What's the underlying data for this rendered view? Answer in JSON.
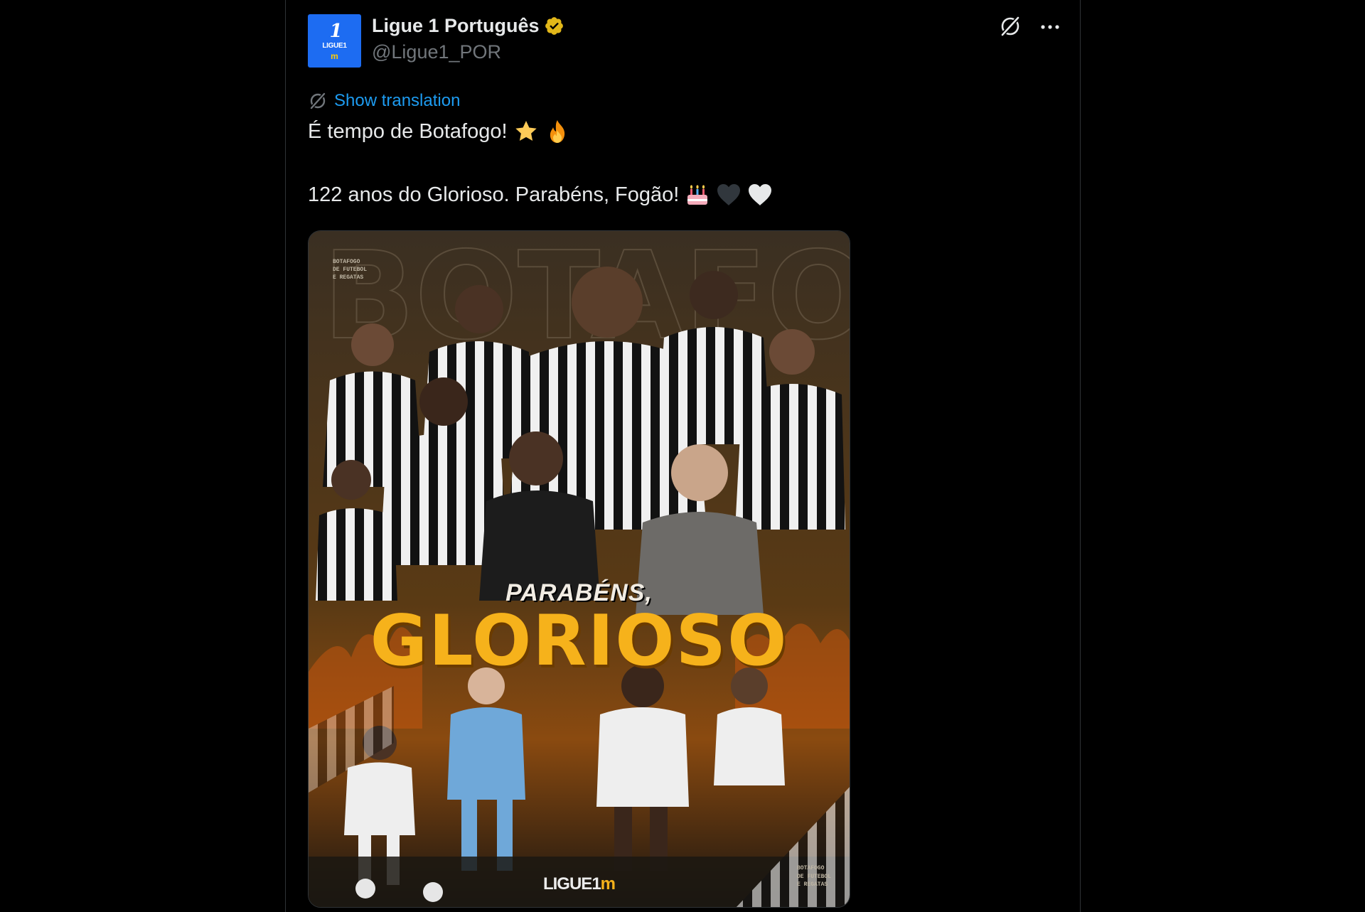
{
  "account": {
    "display_name": "Ligue 1 Português",
    "handle": "@Ligue1_POR",
    "avatar_text": "LIGUE1",
    "verified_color": "#e2b719"
  },
  "actions": {
    "grok_icon": "grok-icon",
    "more_icon": "more-horizontal-icon"
  },
  "translation": {
    "label": "Show translation"
  },
  "tweet": {
    "line1": "É tempo de Botafogo!",
    "line1_emojis": [
      "star",
      "fire"
    ],
    "line2": "122 anos do Glorioso. Parabéns, Fogão!",
    "line2_emojis": [
      "birthday-cake",
      "black-heart",
      "white-heart"
    ]
  },
  "media": {
    "club_text_top": "BOTAFOGO\nDE FUTEBOL\nE REGATAS",
    "club_text_bottom": "BOTAFOGO\nDE FUTEBOL\nE REGATAS",
    "subtitle": "PARABÉNS,",
    "title": "GLORIOSO",
    "logo_text": "LIGUE",
    "logo_mark": "1",
    "logo_arches": "m",
    "accent_color": "#f6b21b"
  },
  "colors": {
    "background": "#000000",
    "link": "#1d9bf0",
    "text": "#e7e9ea",
    "muted": "#71767b",
    "brand": "#1d6cf2"
  }
}
